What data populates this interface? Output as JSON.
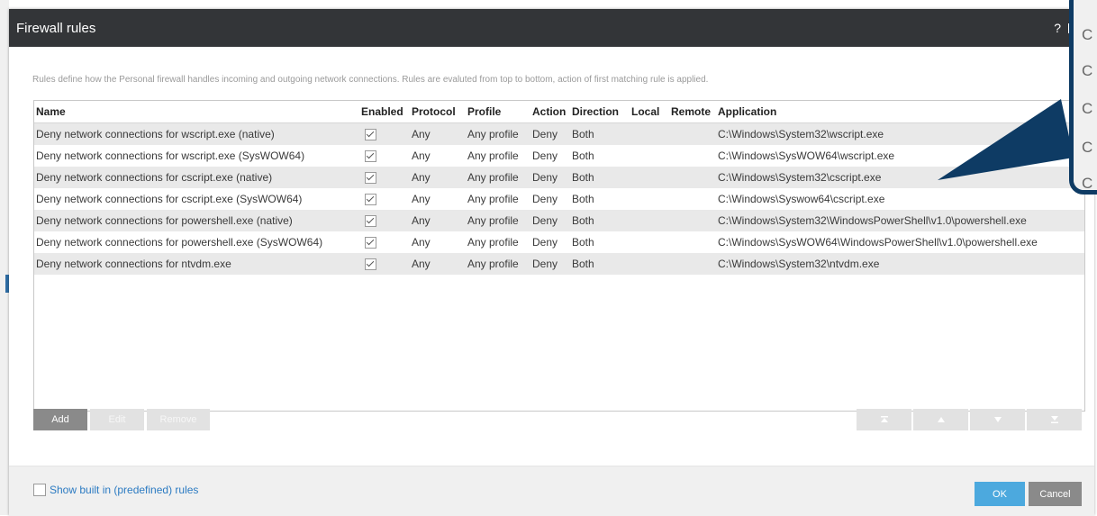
{
  "window": {
    "title": "Firewall rules",
    "help_label": "?"
  },
  "description": "Rules define how the Personal firewall handles incoming and outgoing network connections. Rules are evaluted from top to bottom, action of first matching rule is applied.",
  "table": {
    "columns": [
      "Name",
      "Enabled",
      "Protocol",
      "Profile",
      "Action",
      "Direction",
      "Local",
      "Remote",
      "Application"
    ],
    "rows": [
      {
        "name": "Deny network connections for wscript.exe (native)",
        "enabled": true,
        "protocol": "Any",
        "profile": "Any profile",
        "action": "Deny",
        "direction": "Both",
        "local": "",
        "remote": "",
        "application": "C:\\Windows\\System32\\wscript.exe"
      },
      {
        "name": "Deny network connections for wscript.exe (SysWOW64)",
        "enabled": true,
        "protocol": "Any",
        "profile": "Any profile",
        "action": "Deny",
        "direction": "Both",
        "local": "",
        "remote": "",
        "application": "C:\\Windows\\SysWOW64\\wscript.exe"
      },
      {
        "name": "Deny network connections for cscript.exe (native)",
        "enabled": true,
        "protocol": "Any",
        "profile": "Any profile",
        "action": "Deny",
        "direction": "Both",
        "local": "",
        "remote": "",
        "application": "C:\\Windows\\System32\\cscript.exe"
      },
      {
        "name": "Deny network connections for cscript.exe (SysWOW64)",
        "enabled": true,
        "protocol": "Any",
        "profile": "Any profile",
        "action": "Deny",
        "direction": "Both",
        "local": "",
        "remote": "",
        "application": "C:\\Windows\\Syswow64\\cscript.exe"
      },
      {
        "name": "Deny network connections for powershell.exe (native)",
        "enabled": true,
        "protocol": "Any",
        "profile": "Any profile",
        "action": "Deny",
        "direction": "Both",
        "local": "",
        "remote": "",
        "application": "C:\\Windows\\System32\\WindowsPowerShell\\v1.0\\powershell.exe"
      },
      {
        "name": "Deny network connections for powershell.exe (SysWOW64)",
        "enabled": true,
        "protocol": "Any",
        "profile": "Any profile",
        "action": "Deny",
        "direction": "Both",
        "local": "",
        "remote": "",
        "application": "C:\\Windows\\SysWOW64\\WindowsPowerShell\\v1.0\\powershell.exe"
      },
      {
        "name": "Deny network connections for ntvdm.exe",
        "enabled": true,
        "protocol": "Any",
        "profile": "Any profile",
        "action": "Deny",
        "direction": "Both",
        "local": "",
        "remote": "",
        "application": "C:\\Windows\\System32\\ntvdm.exe"
      }
    ]
  },
  "buttons": {
    "add": "Add",
    "edit": "Edit",
    "remove": "Remove"
  },
  "arrow_buttons": [
    "move-to-top",
    "move-up",
    "move-down",
    "move-to-bottom"
  ],
  "footer": {
    "show_builtin_label": "Show built in (predefined) rules",
    "ok_label": "OK",
    "cancel_label": "Cancel"
  },
  "callout": {
    "items": [
      "C",
      "C",
      "C",
      "C",
      "C"
    ]
  },
  "colors": {
    "titlebar": "#333538",
    "callout_border": "#0e3b64",
    "ok_button": "#4ca9de",
    "link": "#2c7bc2"
  }
}
